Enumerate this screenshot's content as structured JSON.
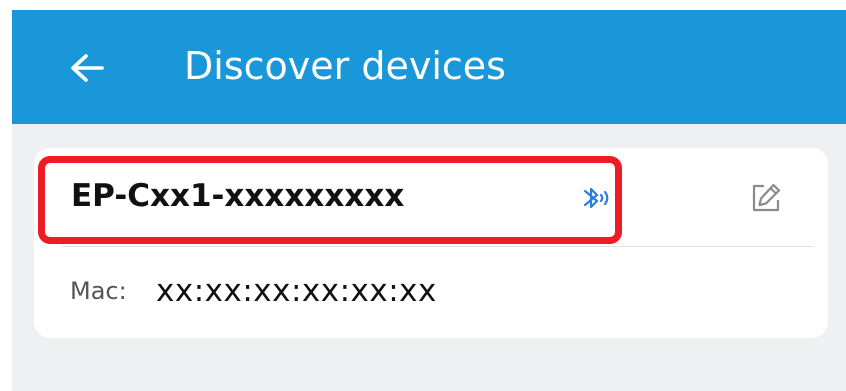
{
  "header": {
    "title": "Discover devices",
    "back_icon": "arrow-left-icon"
  },
  "device": {
    "name": "EP-Cxx1-xxxxxxxxx",
    "status_icon": "bluetooth-audio-icon",
    "edit_icon": "edit-icon",
    "mac_label": "Mac:",
    "mac_value": "xx:xx:xx:xx:xx:xx"
  },
  "colors": {
    "app_bar": "#1a97d9",
    "highlight_border": "#ee1c25",
    "accent_icon": "#2f7de1",
    "background": "#eef0f2"
  }
}
